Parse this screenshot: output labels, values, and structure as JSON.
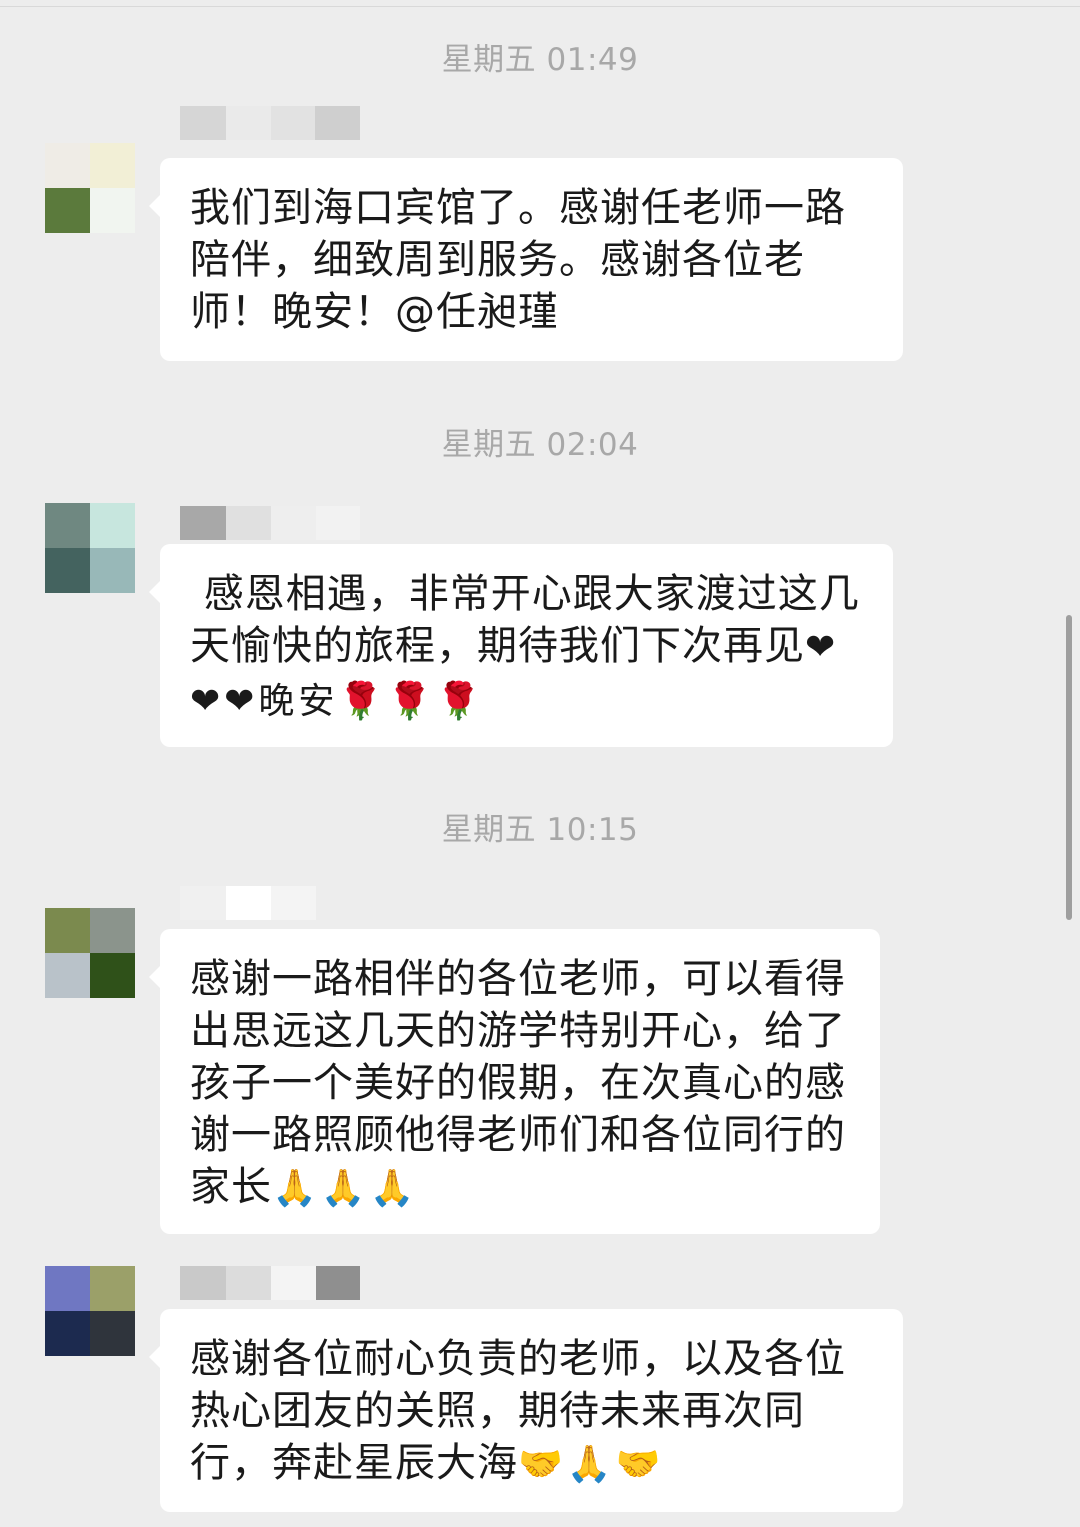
{
  "messages": [
    {
      "timestamp": "星期五 01:49",
      "text": "我们到海口宾馆了。感谢任老师一路陪伴，细致周到服务。感谢各位老师！晚安！@任昶瑾",
      "emoji": "",
      "avatar_colors": [
        "#efece6",
        "#f2efd6",
        "#5b7a3c",
        "#f1f5f0"
      ],
      "name_blur_colors": [
        "#d6d6d6",
        "#eaeaea",
        "#e2e2e2",
        "#cfcfcf"
      ]
    },
    {
      "timestamp": "星期五 02:04",
      "text": " 感恩相遇，非常开心跟大家渡过这几天愉快的旅程，期待我们下次再见",
      "emoji": "❤❤❤晚安🌹🌹🌹",
      "avatar_colors": [
        "#6f8881",
        "#c7e6de",
        "#44635f",
        "#98b8b8"
      ],
      "name_blur_colors": [
        "#a8a8a8",
        "#e0e0e0",
        "#eeeeee",
        "#f2f2f2"
      ]
    },
    {
      "timestamp": "星期五 10:15",
      "text": "感谢一路相伴的各位老师，可以看得出思远这几天的游学特别开心，给了孩子一个美好的假期，在次真心的感谢一路照顾他得老师们和各位同行的家长",
      "emoji": "🙏🙏🙏",
      "avatar_colors": [
        "#7b8a4e",
        "#8b948c",
        "#b9c2c9",
        "#2f5119"
      ],
      "name_blur_colors": [
        "#f0f0f0",
        "#ffffff",
        "#f4f4f4",
        "#ededed"
      ]
    },
    {
      "timestamp": "",
      "text": "感谢各位耐心负责的老师，以及各位热心团友的关照，期待未来再次同行，奔赴星辰大海",
      "emoji": "🤝🙏🤝",
      "avatar_colors": [
        "#6f77c2",
        "#9ba069",
        "#1c2a4f",
        "#2f343c"
      ],
      "name_blur_colors": [
        "#c9c9c9",
        "#dcdcdc",
        "#f4f4f4",
        "#8f8f8f"
      ]
    }
  ]
}
